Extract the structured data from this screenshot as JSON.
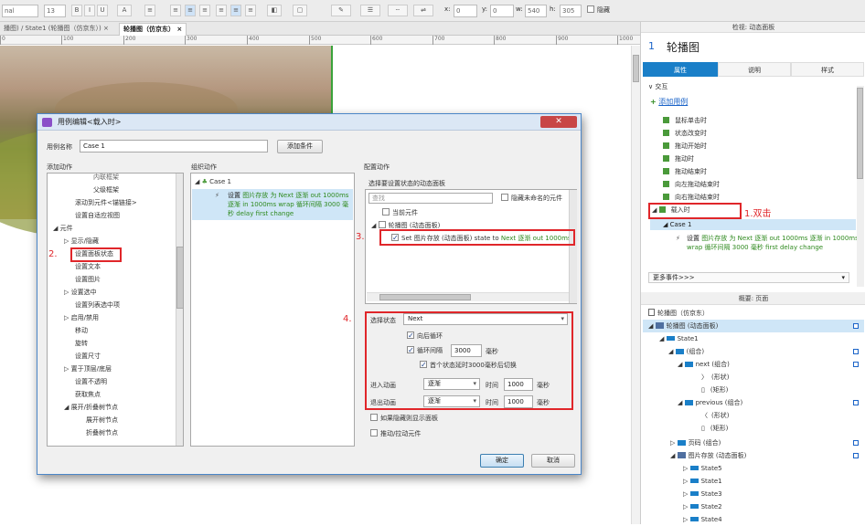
{
  "toolbar": {
    "font": "nal",
    "size": "13",
    "x_label": "x:",
    "x": "0",
    "y_label": "y:",
    "y": "0",
    "w_label": "w:",
    "w": "540",
    "h_label": "h:",
    "h": "305",
    "hidden_label": "隐藏"
  },
  "tabs": [
    "播图) / State1 (轮播图（仿京东）)",
    "轮播图（仿京东）"
  ],
  "ruler": [
    "0",
    "100",
    "200",
    "300",
    "400",
    "500",
    "600",
    "700",
    "800",
    "900",
    "1000"
  ],
  "right": {
    "inspector_title": "检视: 动态面板",
    "number": "1",
    "widget_name": "轮播图",
    "tabs": [
      "属性",
      "说明",
      "样式"
    ],
    "interaction": "交互",
    "add_case": "添加用例",
    "events": [
      "鼠标单击时",
      "状态改变时",
      "拖动开始时",
      "拖动时",
      "拖动结束时",
      "向左拖动结束时",
      "向右拖动结束时"
    ],
    "onload": "载入时",
    "case": "Case 1",
    "case_action_a": "设置 ",
    "case_action_b": "图片存放 为 Next 逐渐 out 1000ms 逐渐 in 1000ms wrap 循环间隔 3000 毫秒 first delay change",
    "more_events": "更多事件>>>",
    "anno1": "1.双击",
    "outline_title": "概要: 页面",
    "outline": [
      "轮播图（仿京东）",
      "轮播图 (动态面板)",
      "State1",
      "(组合)",
      "next (组合)",
      "(形状)",
      "(矩形)",
      "previous (组合)",
      "(形状)",
      "(矩形)",
      "页码 (组合)",
      "图片存放 (动态面板)",
      "State5",
      "State1",
      "State3",
      "State2",
      "State4"
    ]
  },
  "dialog": {
    "title": "用例编辑<载入时>",
    "close": "✕",
    "case_name_label": "用例名称",
    "case_name": "Case 1",
    "add_condition": "添加条件",
    "col1": "添加动作",
    "col2": "组织动作",
    "col3": "配置动作",
    "actions": [
      "内联框架",
      "父级框架",
      "滚动到元件<锚链接>",
      "设置自适应视图",
      "元件",
      "显示/隐藏",
      "设置面板状态",
      "设置文本",
      "设置图片",
      "设置选中",
      "设置列表选中项",
      "启用/禁用",
      "移动",
      "旋转",
      "设置尺寸",
      "置于顶层/底层",
      "设置不透明",
      "获取焦点",
      "展开/折叠树节点",
      "展开树节点",
      "折叠树节点"
    ],
    "org_case": "Case 1",
    "org_action_a": "设置 ",
    "org_action_b": "图片存放 为 Next 逐渐 out 1000ms 逐渐 in 1000ms wrap 循环间隔 3000 毫秒 delay first change",
    "select_panel_label": "选择要设置状态的动态面板",
    "search_placeholder": "查找",
    "hide_unnamed": "隐藏未命名的元件",
    "current_widget": "当前元件",
    "panel_tree_item": "轮播图 (动态面板)",
    "set_state_a": "Set 图片存放 (动态面板) state to ",
    "set_state_b": "Next 逐渐 out 1000ms",
    "select_state_label": "选择状态",
    "select_state_value": "Next",
    "wrap": "向后循环",
    "interval_label": "循环间隔",
    "interval": "3000",
    "ms": "毫秒",
    "first_delay": "首个状态延时3000毫秒后切换",
    "enter_anim": "进入动画",
    "exit_anim": "退出动画",
    "anim_value": "逐渐",
    "time": "时间",
    "time_value": "1000",
    "show_if_hidden": "如果隐藏则显示面板",
    "push_widgets": "推动/拉动元件",
    "ok": "确定",
    "cancel": "取消",
    "anno2": "2.",
    "anno3": "3.",
    "anno4": "4."
  }
}
